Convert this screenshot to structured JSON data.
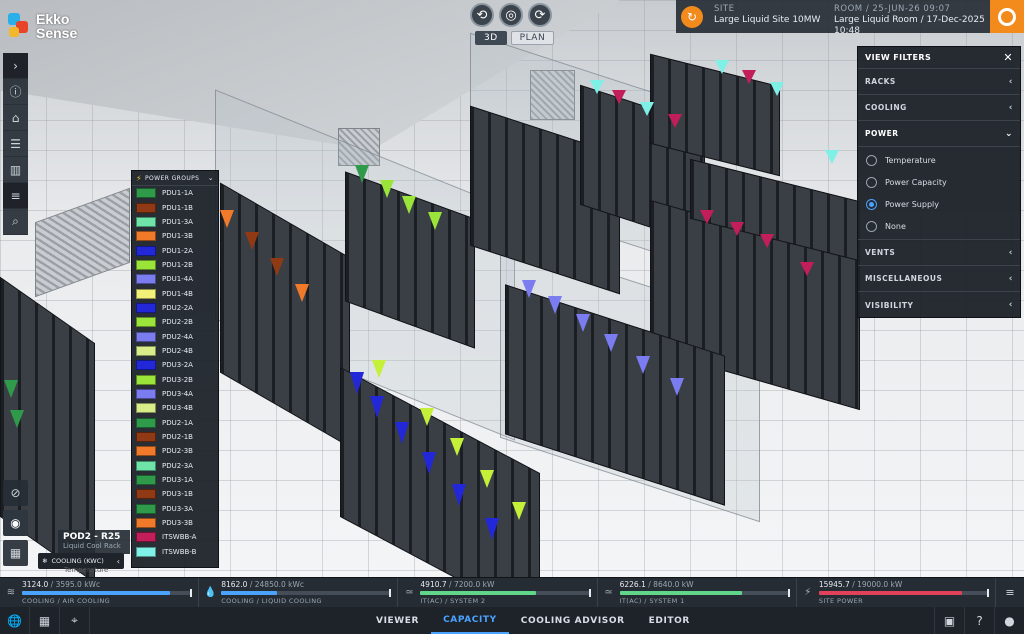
{
  "app": {
    "logo_line1": "Ekko",
    "logo_line2": "Sense"
  },
  "view_controls": {
    "toggle_3d": "3D",
    "toggle_plan": "PLAN"
  },
  "site_info": {
    "site_label": "SITE",
    "site_name": "Large Liquid Site 10MW",
    "room_label": "ROOM / 25-JUN-26 09:07",
    "room_name": "Large Liquid Room / 17-Dec-2025 10:48"
  },
  "power_groups": {
    "title": "POWER GROUPS",
    "items": [
      {
        "label": "PDU1-1A",
        "color": "#2f9a4a"
      },
      {
        "label": "PDU1-1B",
        "color": "#8f3a14"
      },
      {
        "label": "PDU1-3A",
        "color": "#6ee4a8"
      },
      {
        "label": "PDU1-3B",
        "color": "#f07a2a"
      },
      {
        "label": "PDU1-2A",
        "color": "#2228d8"
      },
      {
        "label": "PDU1-2B",
        "color": "#9be43a"
      },
      {
        "label": "PDU1-4A",
        "color": "#7a7cf0"
      },
      {
        "label": "PDU1-4B",
        "color": "#f2f078"
      },
      {
        "label": "PDU2-2A",
        "color": "#2228d8"
      },
      {
        "label": "PDU2-2B",
        "color": "#9be43a"
      },
      {
        "label": "PDU2-4A",
        "color": "#7a7cf0"
      },
      {
        "label": "PDU2-4B",
        "color": "#d8ec8a"
      },
      {
        "label": "PDU3-2A",
        "color": "#2228d8"
      },
      {
        "label": "PDU3-2B",
        "color": "#9be43a"
      },
      {
        "label": "PDU3-4A",
        "color": "#7a7cf0"
      },
      {
        "label": "PDU3-4B",
        "color": "#d8ec8a"
      },
      {
        "label": "PDU2-1A",
        "color": "#2f9a4a"
      },
      {
        "label": "PDU2-1B",
        "color": "#8f3a14"
      },
      {
        "label": "PDU2-3B",
        "color": "#f07a2a"
      },
      {
        "label": "PDU2-3A",
        "color": "#6ee4a8"
      },
      {
        "label": "PDU3-1A",
        "color": "#2f9a4a"
      },
      {
        "label": "PDU3-1B",
        "color": "#8f3a14"
      },
      {
        "label": "PDU3-3A",
        "color": "#2f9a4a"
      },
      {
        "label": "PDU3-3B",
        "color": "#f07a2a"
      },
      {
        "label": "ITSWBB-A",
        "color": "#c21e5a"
      },
      {
        "label": "ITSWBB-B",
        "color": "#7ff0e6"
      }
    ]
  },
  "pod": {
    "title": "POD2 - R25",
    "subtitle": "Liquid Cool Rack",
    "cooling_pill": "COOLING (KWC)",
    "ghost_label": "Temperature"
  },
  "view_filters": {
    "title": "VIEW FILTERS",
    "sections": {
      "racks": "RACKS",
      "cooling": "COOLING",
      "power": "POWER",
      "vents": "VENTS",
      "misc": "MISCELLANEOUS",
      "visibility": "VISIBILITY"
    },
    "power_options": [
      {
        "label": "Temperature",
        "selected": false
      },
      {
        "label": "Power Capacity",
        "selected": false
      },
      {
        "label": "Power Supply",
        "selected": true
      },
      {
        "label": "None",
        "selected": false
      }
    ]
  },
  "metrics": [
    {
      "value": "3124.0",
      "max": "3595.0 kWc",
      "label": "COOLING / AIR COOLING",
      "fraction": 0.869,
      "color": "#4aa3ff"
    },
    {
      "value": "8162.0",
      "max": "24850.0 kWc",
      "label": "COOLING / LIQUID COOLING",
      "fraction": 0.328,
      "color": "#4aa3ff"
    },
    {
      "value": "4910.7",
      "max": "7200.0 kW",
      "label": "IT(AC) / SYSTEM 2",
      "fraction": 0.682,
      "color": "#5fd68a"
    },
    {
      "value": "6226.1",
      "max": "8640.0 kW",
      "label": "IT(AC) / SYSTEM 1",
      "fraction": 0.721,
      "color": "#5fd68a"
    },
    {
      "value": "15945.7",
      "max": "19000.0 kW",
      "label": "SITE POWER",
      "fraction": 0.839,
      "color": "#e2415a"
    }
  ],
  "nav": {
    "tabs": [
      {
        "label": "VIEWER",
        "active": false
      },
      {
        "label": "CAPACITY",
        "active": true
      },
      {
        "label": "COOLING ADVISOR",
        "active": false
      },
      {
        "label": "EDITOR",
        "active": false
      }
    ]
  }
}
